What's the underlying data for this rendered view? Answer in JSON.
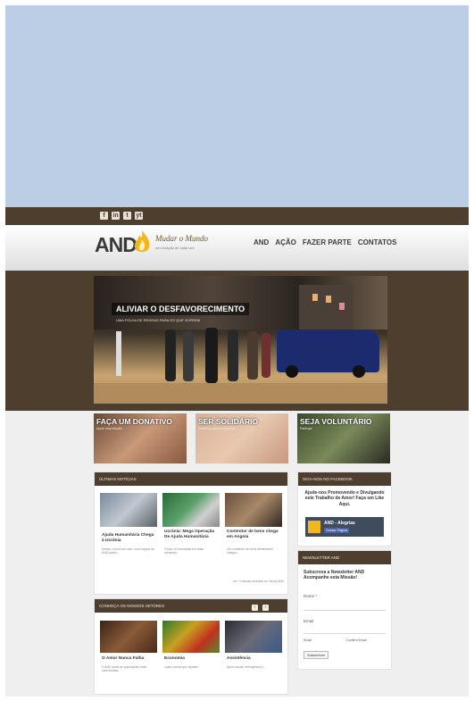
{
  "social": [
    "f",
    "in",
    "t",
    "yt"
  ],
  "logo": {
    "name": "AND",
    "script": "Mudar o Mundo",
    "tagline": "um coração de cada vez"
  },
  "nav": [
    "AND",
    "AÇÃO",
    "FAZER PARTE",
    "CONTATOS"
  ],
  "hero": {
    "title": "ALIVIAR O DESFAVORECIMENTO",
    "subtitle": "UMA FOLHA DE REGRAS PARA OS QUE SOFREM"
  },
  "promos": [
    {
      "label": "FAÇA UM DONATIVO",
      "sub": "Apoie esta missão"
    },
    {
      "label": "SER SOLIDÁRIO",
      "sub": "Contribua para a mudança"
    },
    {
      "label": "SEJA VOLUNTÁRIO",
      "sub": "Participe"
    }
  ],
  "news": {
    "title": "ÚLTIMAS NOTÍCIAS",
    "items": [
      {
        "title": "Ajuda Humanitária Chega à Ucrânia",
        "text": "Desde o início da crise, uma equipa da AND partiu..."
      },
      {
        "title": "Ucrânia: Mega Operação De Ajuda Humanitária",
        "text": "Foram 40 toneladas em duas semanas..."
      },
      {
        "title": "Contentor de bens chega em Angola",
        "text": "Um contentor de bens alimentares chegou..."
      }
    ],
    "more": "ver + notícias recentes no Jornal AND"
  },
  "sectors": {
    "title": "CONHEÇA OS NOSSOS SETORES",
    "items": [
      {
        "title": "O Amor Nunca Falha",
        "text": "A AND apoia as populações mais carenciadas..."
      },
      {
        "title": "Economia",
        "text": "Lojas sociais que apoiam..."
      },
      {
        "title": "Assistência",
        "text": "Apoio social, emergência e..."
      }
    ]
  },
  "facebook": {
    "title": "SIGA-NOS NO FACEBOOK",
    "text": "Ajude-nos Promovendo e Divulgando este Trabalho de Amor! Faça um Like Aqui.",
    "page_name": "AND - Alegrias",
    "like_button": "Gostar Página"
  },
  "newsletter": {
    "title": "NEWSLETTER AND",
    "text": "Subscreva a Newsletter AND Acompanhe esta Missão!",
    "name_label": "Nome *",
    "email_label": "Email",
    "email_small": "Email",
    "confirm_small": "Confirm Email",
    "submit": "Subscrever"
  },
  "colors": {
    "header_brown": "#4e3e2e",
    "background": "#efefef",
    "top_area": "#bccde6"
  }
}
